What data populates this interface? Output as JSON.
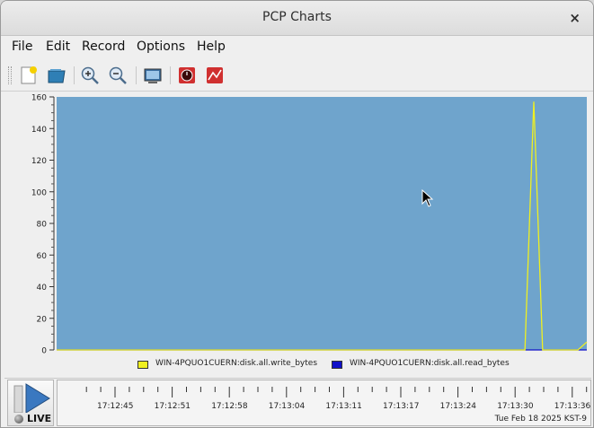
{
  "window": {
    "title": "PCP Charts",
    "close_glyph": "×"
  },
  "menu": [
    "File",
    "Edit",
    "Record",
    "Options",
    "Help"
  ],
  "toolbar": {
    "icons": [
      "new-chart-icon",
      "open-view-icon",
      "zoom-in-icon",
      "zoom-out-icon",
      "export-image-icon",
      "record-icon",
      "chart-type-icon"
    ]
  },
  "chart_data": {
    "type": "line",
    "background": "#6fa4cc",
    "ylim": [
      0,
      160
    ],
    "yticks": [
      "0",
      "20",
      "40",
      "60",
      "80",
      "100",
      "120",
      "140",
      "160"
    ],
    "grid": false,
    "legend_placement": "bottom",
    "x_count": 61,
    "series": [
      {
        "name": "WIN-4PQUO1CUERN:disk.all.write_bytes",
        "color": "#f0f020",
        "points": [
          [
            0,
            0
          ],
          [
            52,
            0
          ],
          [
            53,
            0
          ],
          [
            54,
            157
          ],
          [
            55,
            0
          ],
          [
            58,
            0
          ],
          [
            59,
            0
          ],
          [
            60,
            5
          ]
        ]
      },
      {
        "name": "WIN-4PQUO1CUERN:disk.all.read_bytes",
        "color": "#1010c8",
        "points": [
          [
            0,
            0
          ],
          [
            53,
            0
          ],
          [
            54,
            0
          ],
          [
            55,
            0
          ],
          [
            60,
            0
          ]
        ]
      }
    ]
  },
  "timeline": {
    "labels": [
      "17:12:45",
      "17:12:51",
      "17:12:58",
      "17:13:04",
      "17:13:11",
      "17:13:17",
      "17:13:24",
      "17:13:30",
      "17:13:36"
    ],
    "date": "Tue Feb 18 2025 KST-9"
  },
  "live_label": "LIVE"
}
